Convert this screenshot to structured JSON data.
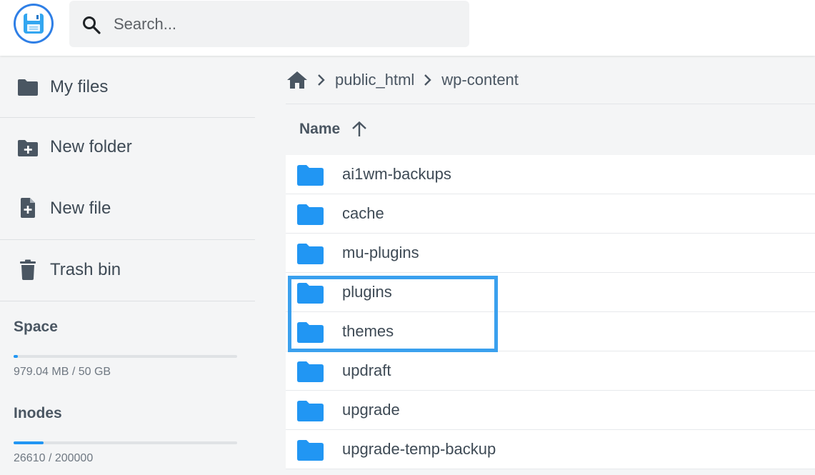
{
  "search": {
    "placeholder": "Search..."
  },
  "sidebar": {
    "items": [
      {
        "label": "My files",
        "icon": "folder-icon"
      },
      {
        "label": "New folder",
        "icon": "folder-plus-icon"
      },
      {
        "label": "New file",
        "icon": "file-plus-icon"
      },
      {
        "label": "Trash bin",
        "icon": "trash-icon"
      }
    ],
    "space": {
      "heading": "Space",
      "usage": "979.04 MB / 50 GB",
      "fraction": 0.019
    },
    "inodes": {
      "heading": "Inodes",
      "usage": "26610 / 200000",
      "fraction": 0.133
    }
  },
  "breadcrumb": {
    "home_icon": "home-icon",
    "items": [
      "public_html",
      "wp-content"
    ]
  },
  "table": {
    "column_name": "Name",
    "sort_icon": "arrow-up-icon",
    "rows": [
      {
        "name": "ai1wm-backups"
      },
      {
        "name": "cache"
      },
      {
        "name": "mu-plugins"
      },
      {
        "name": "plugins"
      },
      {
        "name": "themes"
      },
      {
        "name": "updraft"
      },
      {
        "name": "upgrade"
      },
      {
        "name": "upgrade-temp-backup"
      }
    ]
  },
  "colors": {
    "accent": "#2196f3",
    "highlight_border": "#3aa0ee",
    "logo_ring": "#2f7fe6"
  }
}
